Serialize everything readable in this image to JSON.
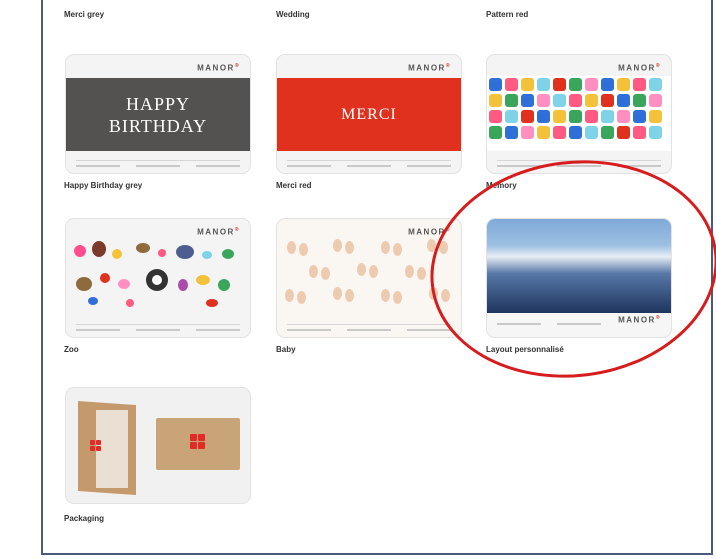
{
  "top_labels": [
    "Merci grey",
    "Wedding",
    "Pattern red"
  ],
  "cards": [
    {
      "label": "Happy Birthday grey",
      "text_line1": "HAPPY",
      "text_line2": "BIRTHDAY",
      "brand": "MANOR"
    },
    {
      "label": "Merci red",
      "text": "MERCI",
      "brand": "MANOR"
    },
    {
      "label": "Memory",
      "brand": "MANOR"
    },
    {
      "label": "Zoo",
      "brand": "MANOR"
    },
    {
      "label": "Baby",
      "brand": "MANOR"
    },
    {
      "label": "Layout personnalisé",
      "brand": "MANOR"
    },
    {
      "label": "Packaging"
    }
  ],
  "colors": {
    "highlight": "#d61c1c",
    "brand_red": "#e0301e",
    "frame": "#4a5a78"
  }
}
